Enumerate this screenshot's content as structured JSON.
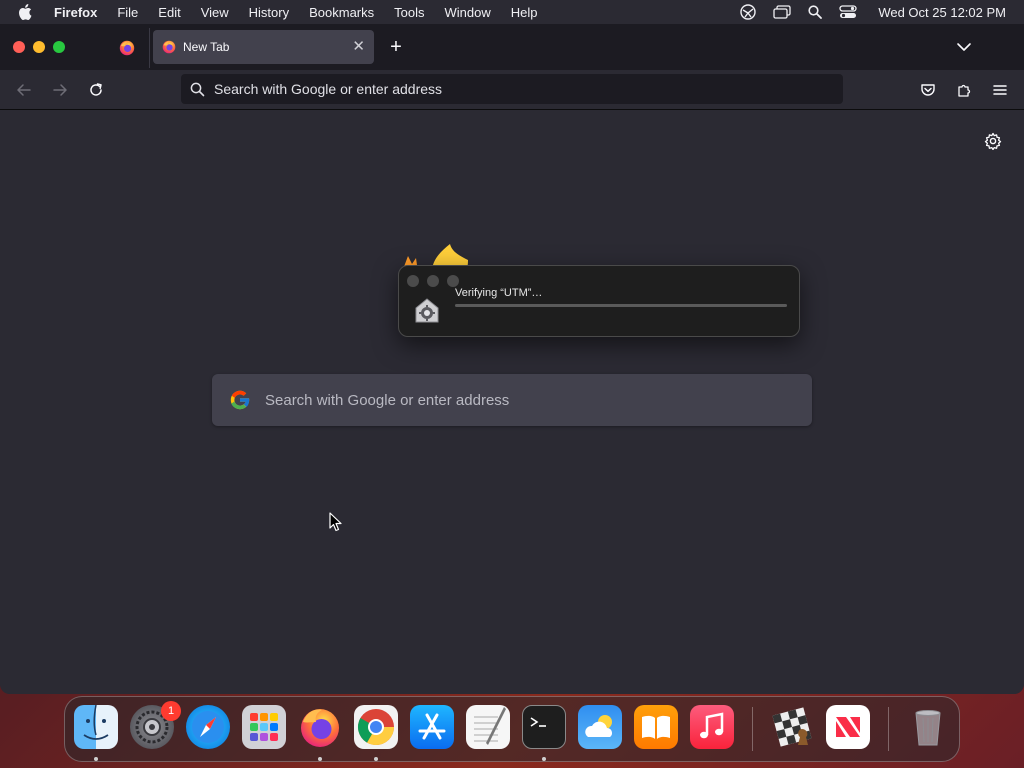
{
  "menubar": {
    "app_name": "Firefox",
    "items": [
      "File",
      "Edit",
      "View",
      "History",
      "Bookmarks",
      "Tools",
      "Window",
      "Help"
    ],
    "clock": "Wed Oct 25  12:02 PM"
  },
  "browser": {
    "active_tab_title": "New Tab",
    "new_tab_symbol": "+",
    "close_tab_symbol": "✕",
    "urlbar_placeholder": "Search with Google or enter address"
  },
  "newtab": {
    "search_placeholder": "Search with Google or enter address"
  },
  "dialog": {
    "message": "Verifying “UTM”…",
    "progress_fraction": 0.0
  },
  "dock": {
    "apps": [
      {
        "name": "Finder",
        "icon": "finder-icon",
        "running": true
      },
      {
        "name": "System Settings",
        "icon": "system-settings-icon",
        "running": false,
        "badge": "1"
      },
      {
        "name": "Safari",
        "icon": "safari-icon",
        "running": false
      },
      {
        "name": "Launchpad",
        "icon": "launchpad-icon",
        "running": false
      },
      {
        "name": "Firefox",
        "icon": "firefox-icon",
        "running": true
      },
      {
        "name": "Google Chrome",
        "icon": "chrome-icon",
        "running": true
      },
      {
        "name": "App Store",
        "icon": "app-store-icon",
        "running": false
      },
      {
        "name": "TextEdit",
        "icon": "textedit-icon",
        "running": false
      },
      {
        "name": "Terminal",
        "icon": "terminal-icon",
        "running": true
      },
      {
        "name": "Weather",
        "icon": "weather-icon",
        "running": false
      },
      {
        "name": "Books",
        "icon": "books-icon",
        "running": false
      },
      {
        "name": "Music",
        "icon": "music-icon",
        "running": false
      },
      {
        "name": "Chess",
        "icon": "chess-icon",
        "running": false
      },
      {
        "name": "News",
        "icon": "news-icon",
        "running": false
      },
      {
        "name": "Trash",
        "icon": "trash-icon",
        "running": false
      }
    ]
  },
  "colors": {
    "menubar_bg": "#2b2a33",
    "tabbar_bg": "#1c1b22",
    "content_bg": "#2b2a33",
    "search_bg": "#42414d",
    "close_red": "#ff5f57",
    "min_yellow": "#febc2e",
    "max_green": "#28c840"
  }
}
